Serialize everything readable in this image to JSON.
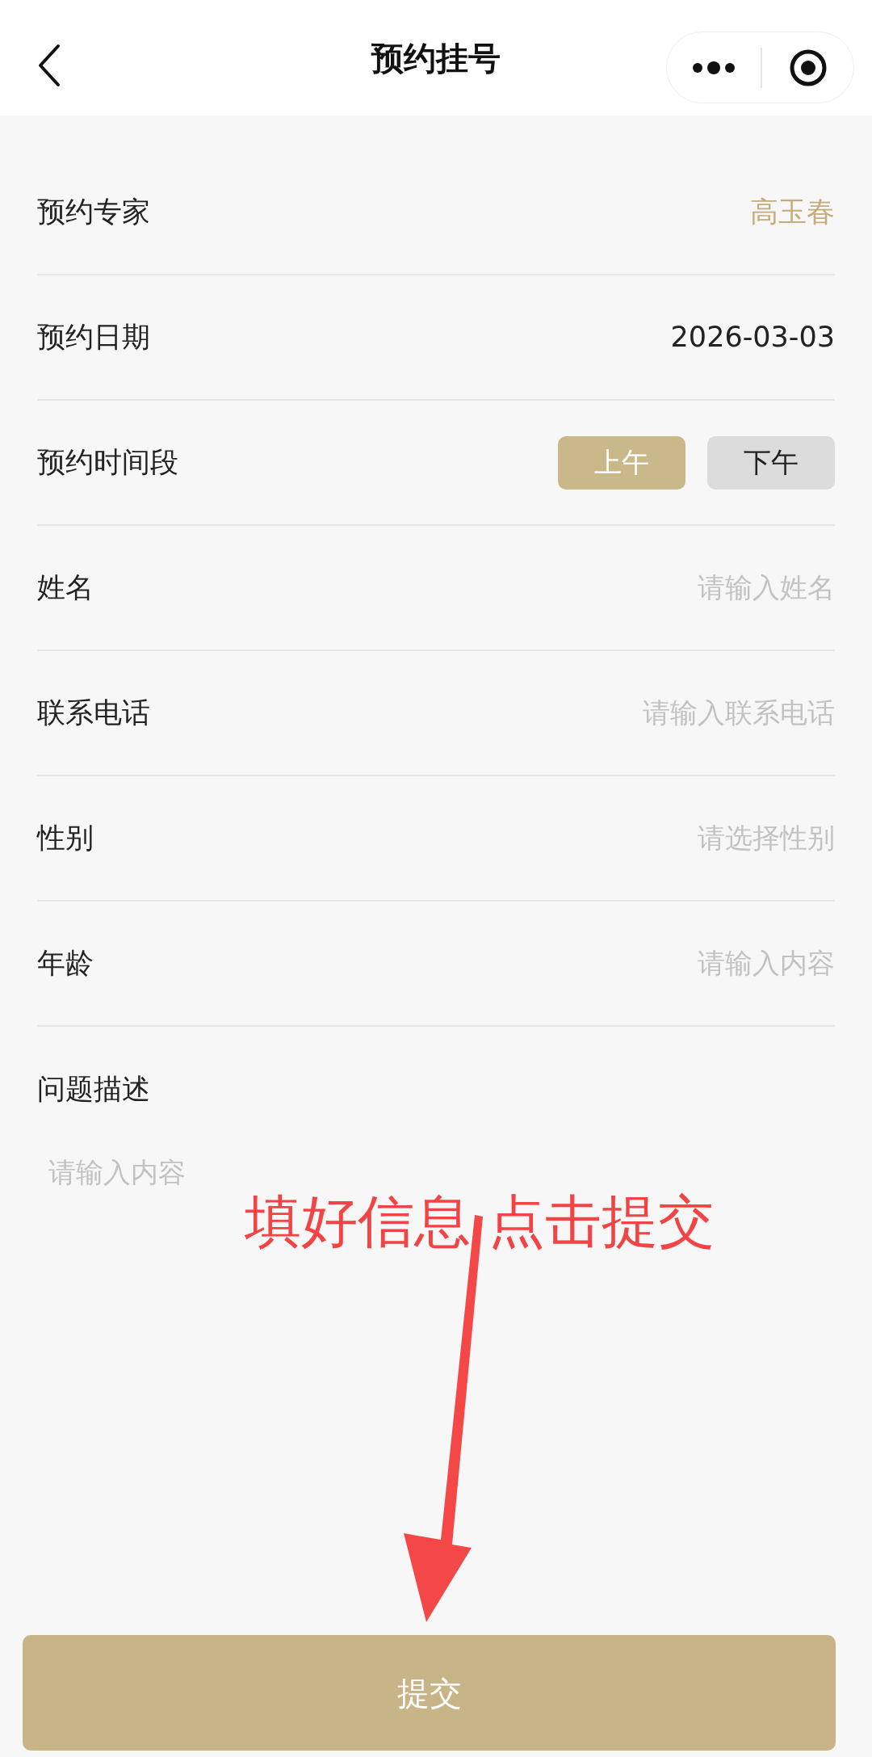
{
  "header": {
    "title": "预约挂号"
  },
  "fields": [
    {
      "kind": "value",
      "label": "预约专家",
      "value": "高玉春",
      "accent": true
    },
    {
      "kind": "value",
      "label": "预约日期",
      "value": "2026-03-03",
      "accent": false
    },
    {
      "kind": "segments",
      "label": "预约时间段",
      "options": [
        {
          "label": "上午",
          "selected": true
        },
        {
          "label": "下午",
          "selected": false
        }
      ]
    },
    {
      "kind": "input",
      "label": "姓名",
      "placeholder": "请输入姓名"
    },
    {
      "kind": "input",
      "label": "联系电话",
      "placeholder": "请输入联系电话"
    },
    {
      "kind": "input",
      "label": "性别",
      "placeholder": "请选择性别"
    },
    {
      "kind": "input",
      "label": "年龄",
      "placeholder": "请输入内容"
    }
  ],
  "description": {
    "label": "问题描述",
    "placeholder": "请输入内容"
  },
  "annotation": {
    "text": "填好信息 点击提交"
  },
  "submit": {
    "label": "提交"
  }
}
